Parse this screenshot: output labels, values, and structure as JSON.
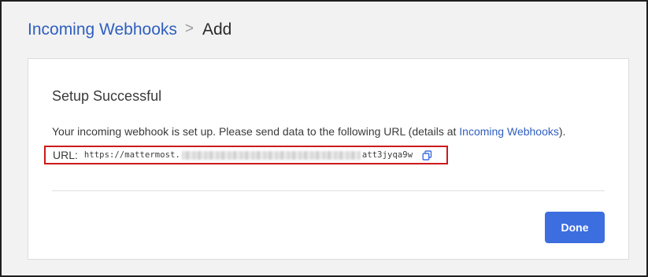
{
  "breadcrumb": {
    "parent": "Incoming Webhooks",
    "separator": ">",
    "current": "Add"
  },
  "card": {
    "title": "Setup Successful",
    "description_prefix": "Your incoming webhook is set up. Please send data to the following URL (details at ",
    "description_link": "Incoming Webhooks",
    "description_suffix": ").",
    "url_label": "URL:",
    "url_start": "https://mattermost.",
    "url_end": "att3jyqa9w",
    "copy_icon": "copy-icon",
    "done_label": "Done"
  },
  "colors": {
    "link": "#2f5fbf",
    "primary_button": "#3d6ee0",
    "highlight_border": "#cc1a1a"
  }
}
